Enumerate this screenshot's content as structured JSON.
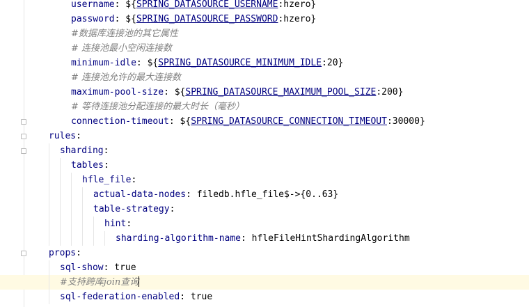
{
  "editor": {
    "lines": [
      {
        "id": "l0",
        "indent": 2,
        "type": "env",
        "key": "username",
        "prefix": "${",
        "env": "SPRING_DATASOURCE_USERNAME",
        "default": "hzero",
        "suffix": "}"
      },
      {
        "id": "l1",
        "indent": 2,
        "type": "env",
        "key": "password",
        "prefix": "${",
        "env": "SPRING_DATASOURCE_PASSWORD",
        "default": "hzero",
        "suffix": "}"
      },
      {
        "id": "l2",
        "indent": 2,
        "type": "comment",
        "text": "#数据库连接池的其它属性"
      },
      {
        "id": "l3",
        "indent": 2,
        "type": "comment",
        "text": "# 连接池最小空闲连接数"
      },
      {
        "id": "l4",
        "indent": 2,
        "type": "env",
        "key": "minimum-idle",
        "prefix": "${",
        "env": "SPRING_DATASOURCE_MINIMUM_IDLE",
        "default": "20",
        "suffix": "}"
      },
      {
        "id": "l5",
        "indent": 2,
        "type": "comment",
        "text": "# 连接池允许的最大连接数"
      },
      {
        "id": "l6",
        "indent": 2,
        "type": "env",
        "key": "maximum-pool-size",
        "prefix": "${",
        "env": "SPRING_DATASOURCE_MAXIMUM_POOL_SIZE",
        "default": "200",
        "suffix": "}"
      },
      {
        "id": "l7",
        "indent": 2,
        "type": "comment",
        "text": "# 等待连接池分配连接的最大时长（毫秒）"
      },
      {
        "id": "l8",
        "indent": 2,
        "type": "env",
        "key": "connection-timeout",
        "prefix": "${",
        "env": "SPRING_DATASOURCE_CONNECTION_TIMEOUT",
        "default": "30000",
        "suffix": "}"
      },
      {
        "id": "l9",
        "indent": 0,
        "type": "key",
        "key": "rules"
      },
      {
        "id": "l10",
        "indent": 1,
        "type": "key",
        "key": "sharding"
      },
      {
        "id": "l11",
        "indent": 2,
        "type": "key",
        "key": "tables"
      },
      {
        "id": "l12",
        "indent": 3,
        "type": "key",
        "key": "hfle_file"
      },
      {
        "id": "l13",
        "indent": 4,
        "type": "kv",
        "key": "actual-data-nodes",
        "value": "filedb.hfle_file$->{0..63}"
      },
      {
        "id": "l14",
        "indent": 4,
        "type": "key",
        "key": "table-strategy"
      },
      {
        "id": "l15",
        "indent": 5,
        "type": "key",
        "key": "hint"
      },
      {
        "id": "l16",
        "indent": 6,
        "type": "kv",
        "key": "sharding-algorithm-name",
        "value": "hfleFileHintShardingAlgorithm"
      },
      {
        "id": "l17",
        "indent": 0,
        "type": "key",
        "key": "props"
      },
      {
        "id": "l18",
        "indent": 1,
        "type": "kv",
        "key": "sql-show",
        "value": "true"
      },
      {
        "id": "l19",
        "indent": 1,
        "type": "comment",
        "text": "#支持跨库join查询",
        "current": true
      },
      {
        "id": "l20",
        "indent": 1,
        "type": "kv",
        "key": "sql-federation-enabled",
        "value": "true"
      }
    ]
  }
}
